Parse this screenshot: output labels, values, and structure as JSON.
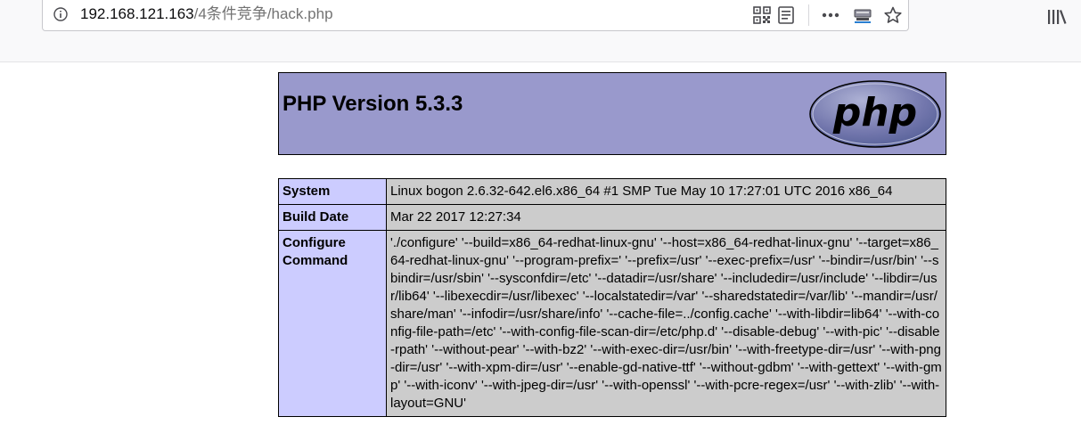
{
  "browser": {
    "url_host": "192.168.121.163",
    "url_path": "/4条件竞争/hack.php",
    "icons": {
      "site_info": "info-icon",
      "qr_code": "qr-code-icon",
      "reader_view": "reader-view-icon",
      "page_actions": "more-icon",
      "save_to_pocket": "pocket-icon",
      "bookmark": "star-icon",
      "library": "library-icon"
    }
  },
  "phpinfo": {
    "title": "PHP Version 5.3.3",
    "logo_text": "php",
    "colors": {
      "header_bg": "#9999cc",
      "label_bg": "#ccccff",
      "value_bg": "#cccccc"
    },
    "rows": [
      {
        "label": "System",
        "value": "Linux bogon 2.6.32-642.el6.x86_64 #1 SMP Tue May 10 17:27:01 UTC 2016 x86_64"
      },
      {
        "label": "Build Date",
        "value": "Mar 22 2017 12:27:34"
      },
      {
        "label": "Configure Command",
        "value": "'./configure' '--build=x86_64-redhat-linux-gnu' '--host=x86_64-redhat-linux-gnu' '--target=x86_64-redhat-linux-gnu' '--program-prefix=' '--prefix=/usr' '--exec-prefix=/usr' '--bindir=/usr/bin' '--sbindir=/usr/sbin' '--sysconfdir=/etc' '--datadir=/usr/share' '--includedir=/usr/include' '--libdir=/usr/lib64' '--libexecdir=/usr/libexec' '--localstatedir=/var' '--sharedstatedir=/var/lib' '--mandir=/usr/share/man' '--infodir=/usr/share/info' '--cache-file=../config.cache' '--with-libdir=lib64' '--with-config-file-path=/etc' '--with-config-file-scan-dir=/etc/php.d' '--disable-debug' '--with-pic' '--disable-rpath' '--without-pear' '--with-bz2' '--with-exec-dir=/usr/bin' '--with-freetype-dir=/usr' '--with-png-dir=/usr' '--with-xpm-dir=/usr' '--enable-gd-native-ttf' '--without-gdbm' '--with-gettext' '--with-gmp' '--with-iconv' '--with-jpeg-dir=/usr' '--with-openssl' '--with-pcre-regex=/usr' '--with-zlib' '--with-layout=GNU'"
      }
    ]
  }
}
